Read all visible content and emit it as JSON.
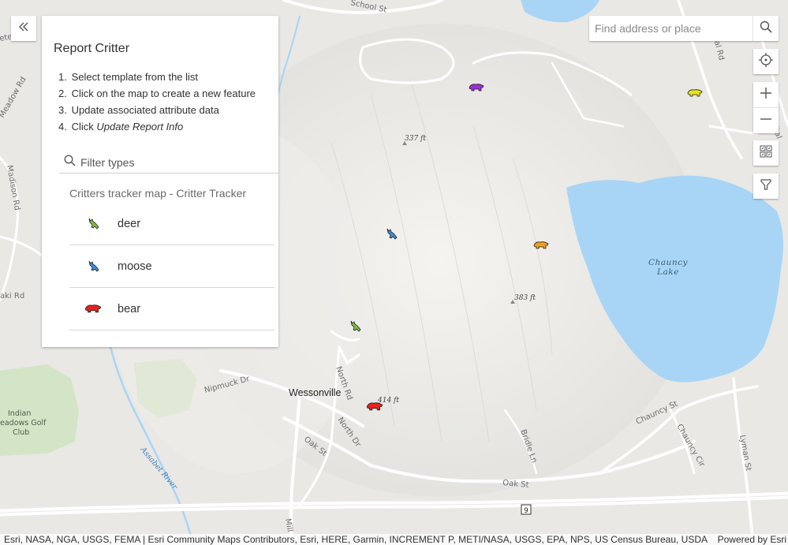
{
  "panel": {
    "title": "Report Critter",
    "steps": [
      {
        "num": "1.",
        "text": "Select template from the list"
      },
      {
        "num": "2.",
        "text": "Click on the map to create a new feature"
      },
      {
        "num": "3.",
        "text": "Update associated attribute data"
      },
      {
        "num": "4.",
        "text": "Click ",
        "em": "Update Report Info"
      }
    ],
    "filter_placeholder": "Filter types",
    "layer_title": "Critters tracker map - Critter Tracker",
    "types": [
      {
        "label": "deer",
        "icon": "deer-icon",
        "color": "#7ac143"
      },
      {
        "label": "moose",
        "icon": "moose-icon",
        "color": "#3d8ed6"
      },
      {
        "label": "bear",
        "icon": "bear-icon",
        "color": "#e8231f"
      }
    ]
  },
  "search": {
    "placeholder": "Find address or place"
  },
  "map_controls": [
    "locate-icon",
    "zoom-in-icon",
    "zoom-out-icon",
    "basemap-gallery-icon",
    "filter-icon"
  ],
  "map_labels": {
    "school_st": "School St",
    "meadow_rd": "Meadow Rd",
    "madison_rd": "Madison Rd",
    "aki_rd": "aki Rd",
    "elev_337": "337 ft",
    "elev_383": "383 ft",
    "elev_414": "414 ft",
    "lake": "Chauncy Lake",
    "nipmuck_dr": "Nipmuck Dr",
    "wessonville": "Wessonville",
    "north_rd": "North Rd",
    "north_dr": "North Dr",
    "oak_st": "Oak St",
    "bridle_ln": "Bridle Ln",
    "chauncy_st": "Chauncy St",
    "chauncy_cir": "Chauncy Cir",
    "lyman_st": "Lyman St",
    "assabet_river": "Assabet River",
    "golf_club": "Indian Meadows Golf Club",
    "route_9": "9",
    "mill_st": "Mill",
    "ital": "ital Rd",
    "ete": "ete"
  },
  "critters_on_map": [
    {
      "type": "bear",
      "color": "#9b30d9"
    },
    {
      "type": "bear",
      "color": "#e6e619"
    },
    {
      "type": "moose",
      "color": "#3d8ed6"
    },
    {
      "type": "bear",
      "color": "#f0a020"
    },
    {
      "type": "deer",
      "color": "#7ac143"
    },
    {
      "type": "bear",
      "color": "#e8231f"
    }
  ],
  "attribution": {
    "left": "Esri, NASA, NGA, USGS, FEMA | Esri Community Maps Contributors, Esri, HERE, Garmin, INCREMENT P, METI/NASA, USGS, EPA, NPS, US Census Bureau, USDA",
    "right": "Powered by Esri"
  }
}
